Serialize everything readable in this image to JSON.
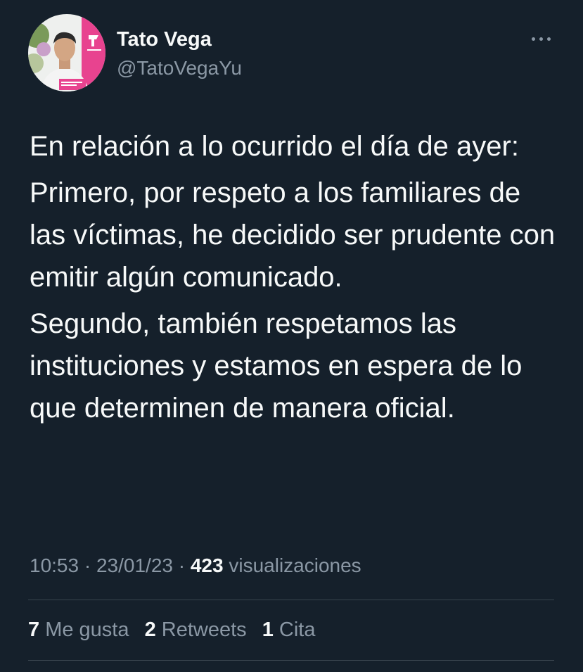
{
  "tweet": {
    "author": {
      "name": "Tato Vega",
      "handle": "@TatoVegaYu",
      "avatar_badge_top": "TATO VEGA",
      "avatar_badge_bottom": "LO NUEVO VIENE CON FUERZA"
    },
    "more_icon": "more-horizontal-icon",
    "body": {
      "p1": "En relación a lo ocurrido el día de ayer:",
      "p2": "Primero, por respeto a los familiares de las víctimas, he decidido ser prudente con emitir algún comunicado.",
      "p3": "Segundo, también respetamos las instituciones y estamos en espera de lo que determinen de manera oficial."
    },
    "meta": {
      "time": "10:53",
      "separator": "·",
      "date": "23/01/23",
      "views_count": "423",
      "views_label": "visualizaciones"
    },
    "stats": {
      "likes_count": "7",
      "likes_label": "Me gusta",
      "retweets_count": "2",
      "retweets_label": "Retweets",
      "quotes_count": "1",
      "quotes_label": "Cita"
    }
  },
  "colors": {
    "background": "#15202b",
    "primary_text": "#f7f9f9",
    "secondary_text": "#8b98a5",
    "divider": "#38444d",
    "avatar_accent": "#e8438f"
  }
}
